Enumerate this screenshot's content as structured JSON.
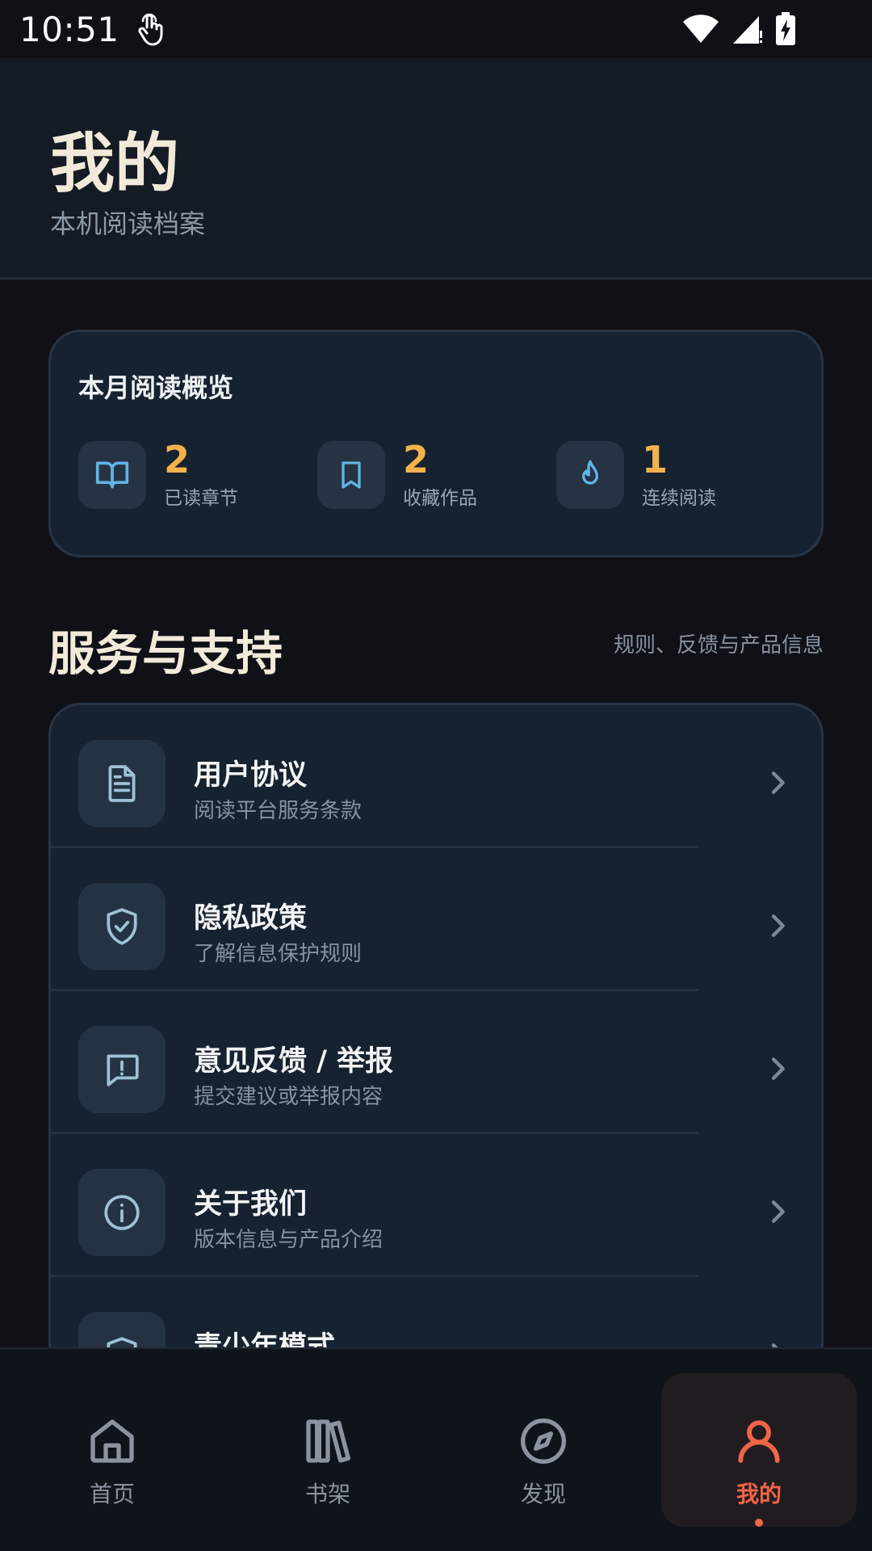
{
  "status_bar": {
    "time": "10:51"
  },
  "header": {
    "title": "我的",
    "subtitle": "本机阅读档案"
  },
  "overview": {
    "title": "本月阅读概览",
    "stats": [
      {
        "icon": "book-open-icon",
        "value": "2",
        "label": "已读章节"
      },
      {
        "icon": "bookmark-icon",
        "value": "2",
        "label": "收藏作品"
      },
      {
        "icon": "flame-icon",
        "value": "1",
        "label": "连续阅读"
      }
    ]
  },
  "services": {
    "title": "服务与支持",
    "caption": "规则、反馈与产品信息",
    "items": [
      {
        "icon": "document-icon",
        "title": "用户协议",
        "desc": "阅读平台服务条款"
      },
      {
        "icon": "shield-check-icon",
        "title": "隐私政策",
        "desc": "了解信息保护规则"
      },
      {
        "icon": "feedback-icon",
        "title": "意见反馈 / 举报",
        "desc": "提交建议或举报内容"
      },
      {
        "icon": "info-icon",
        "title": "关于我们",
        "desc": "版本信息与产品介绍"
      },
      {
        "icon": "shield-icon",
        "title": "青少年模式",
        "desc": ""
      }
    ]
  },
  "bottom_nav": {
    "items": [
      {
        "icon": "home-icon",
        "label": "首页",
        "active": false
      },
      {
        "icon": "bookshelf-icon",
        "label": "书架",
        "active": false
      },
      {
        "icon": "compass-icon",
        "label": "发现",
        "active": false
      },
      {
        "icon": "user-icon",
        "label": "我的",
        "active": true
      }
    ]
  },
  "colors": {
    "accent": "#f06448",
    "stat_value": "#f3b24c",
    "icon_blue": "#5fb5e6"
  }
}
